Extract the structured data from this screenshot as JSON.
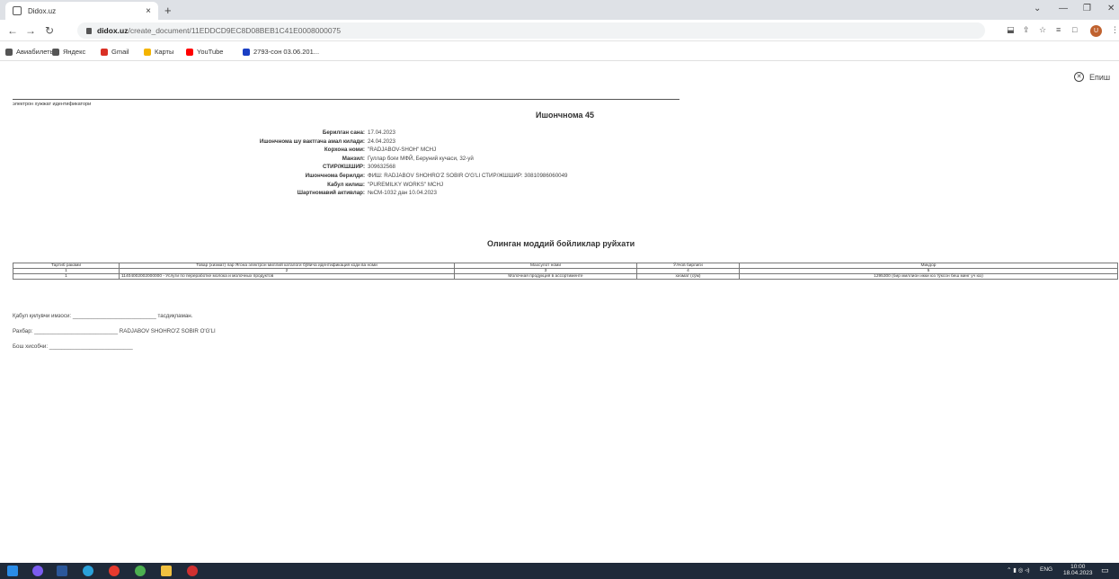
{
  "browser": {
    "tab_title": "Didox.uz",
    "tab_close": "×",
    "new_tab": "+",
    "url_domain": "didox.uz",
    "url_path": "/create_document/11EDDCD9EC8D08BEB1C41E0008000075",
    "bookmarks": [
      {
        "label": "Авиабилеты",
        "icon_color": "#555555"
      },
      {
        "label": "Яндекс",
        "icon_color": "#555555"
      },
      {
        "label": "Gmail",
        "icon_color": "#d93025"
      },
      {
        "label": "Карты",
        "icon_color": "#f4b400"
      },
      {
        "label": "YouTube",
        "icon_color": "#ff0000"
      },
      {
        "label": "2793-сон 03.06.201...",
        "icon_color": "#1a3fc4"
      }
    ],
    "avatar_letter": "U"
  },
  "page": {
    "exit_label": "Епиш",
    "doc_id_label": "электрон хужжат идентификатори",
    "title": "Ишончнома 45",
    "fields": [
      {
        "label": "Берилган сана:",
        "value": "17.04.2023"
      },
      {
        "label": "Ишончнома шу вактгача амал килади:",
        "value": "24.04.2023"
      },
      {
        "label": "Корхона номи:",
        "value": "\"RADJABOV-SHOH\" MCHJ"
      },
      {
        "label": "Манзил:",
        "value": "Гуллар боғи МФЙ, Беруний кучаси, 32-уй"
      },
      {
        "label": "СТИР/ЖШШИР:",
        "value": "309632568"
      },
      {
        "label": "Ишончнома берилди:",
        "value": "ФИШ:   RADJABOV SHOHRO'Z SOBIR O'G'LI   СТИР/ЖШШИР:   30810986060049"
      },
      {
        "label": "Кабул килиш:",
        "value": "\"PUREMILKY WORKS\" MCHJ"
      },
      {
        "label": "Шартномавий активлар:",
        "value": "№СМ-1032 дан 10.04.2023"
      }
    ],
    "section_title": "Олинган моддий бойликлар руйхати",
    "table": {
      "headers": [
        "Тартиб раками",
        "Товар (хизмат) лар Ягона электрон миллий каталоги бўйича идентификация коди ва номи",
        "Махсулот номи",
        "Ўлчов бирлиги",
        "Микдор"
      ],
      "numbers": [
        "1",
        "2",
        "3",
        "4",
        "5"
      ],
      "rows": [
        [
          "1",
          "11404002002000000 - Услуги по переработке молока и молочных продуктов",
          "Молочная продукция в ассортименте",
          "хизмат (сўм)",
          "1295300 (бир миллион икки юз тўксон беш минг уч юз)"
        ]
      ]
    },
    "signatures": [
      "Қабул қилувчи имзоси: ___________________________ тасдиқламан.",
      "Рахбар: ___________________________ RADJABOV SHOHRO'Z SOBIR O'G'LI",
      "Бош хисобчи: ___________________________"
    ]
  },
  "taskbar": {
    "lang": "ENG",
    "time": "10:00",
    "date": "18.04.2023"
  }
}
